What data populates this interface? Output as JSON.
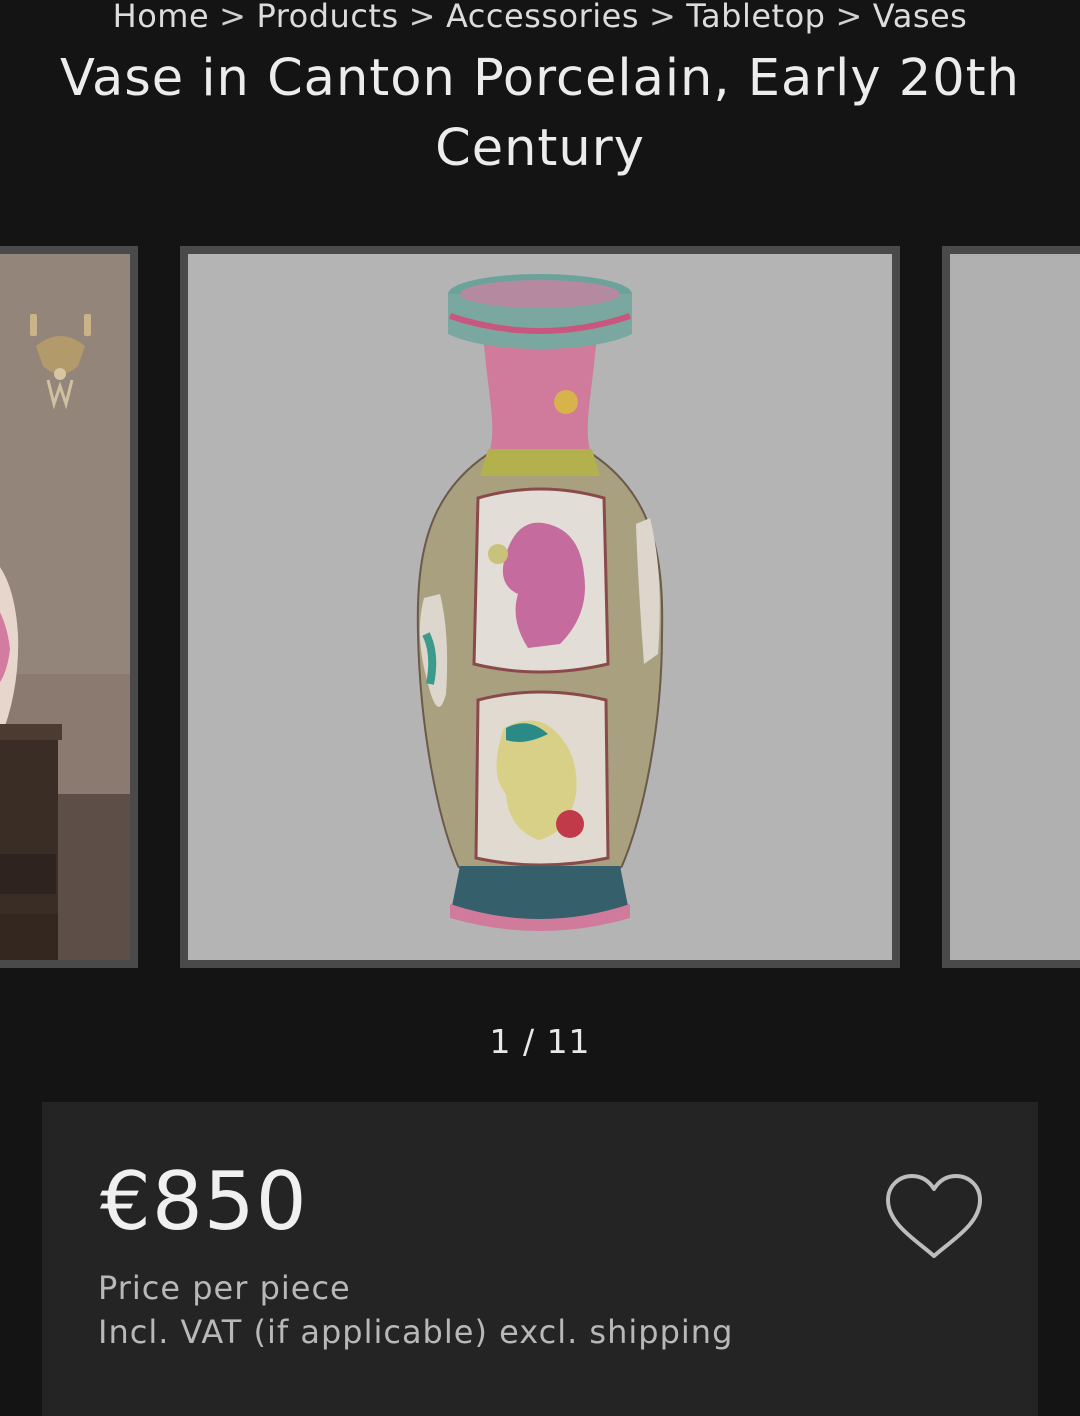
{
  "breadcrumb": {
    "items": [
      "Home",
      "Products",
      "Accessories",
      "Tabletop",
      "Vases"
    ],
    "separator": ">"
  },
  "product": {
    "title": "Vase in Canton Porcelain, Early 20th Century"
  },
  "gallery": {
    "current": "1",
    "separator": "/",
    "total": "11"
  },
  "pricing": {
    "price": "€850",
    "unit_note": "Price per piece",
    "tax_note": "Incl. VAT (if applicable) excl. shipping"
  },
  "icons": {
    "wishlist": "heart-outline-icon"
  },
  "colors": {
    "background": "#141414",
    "card": "#242424",
    "slide_border": "#4a4a4a"
  }
}
